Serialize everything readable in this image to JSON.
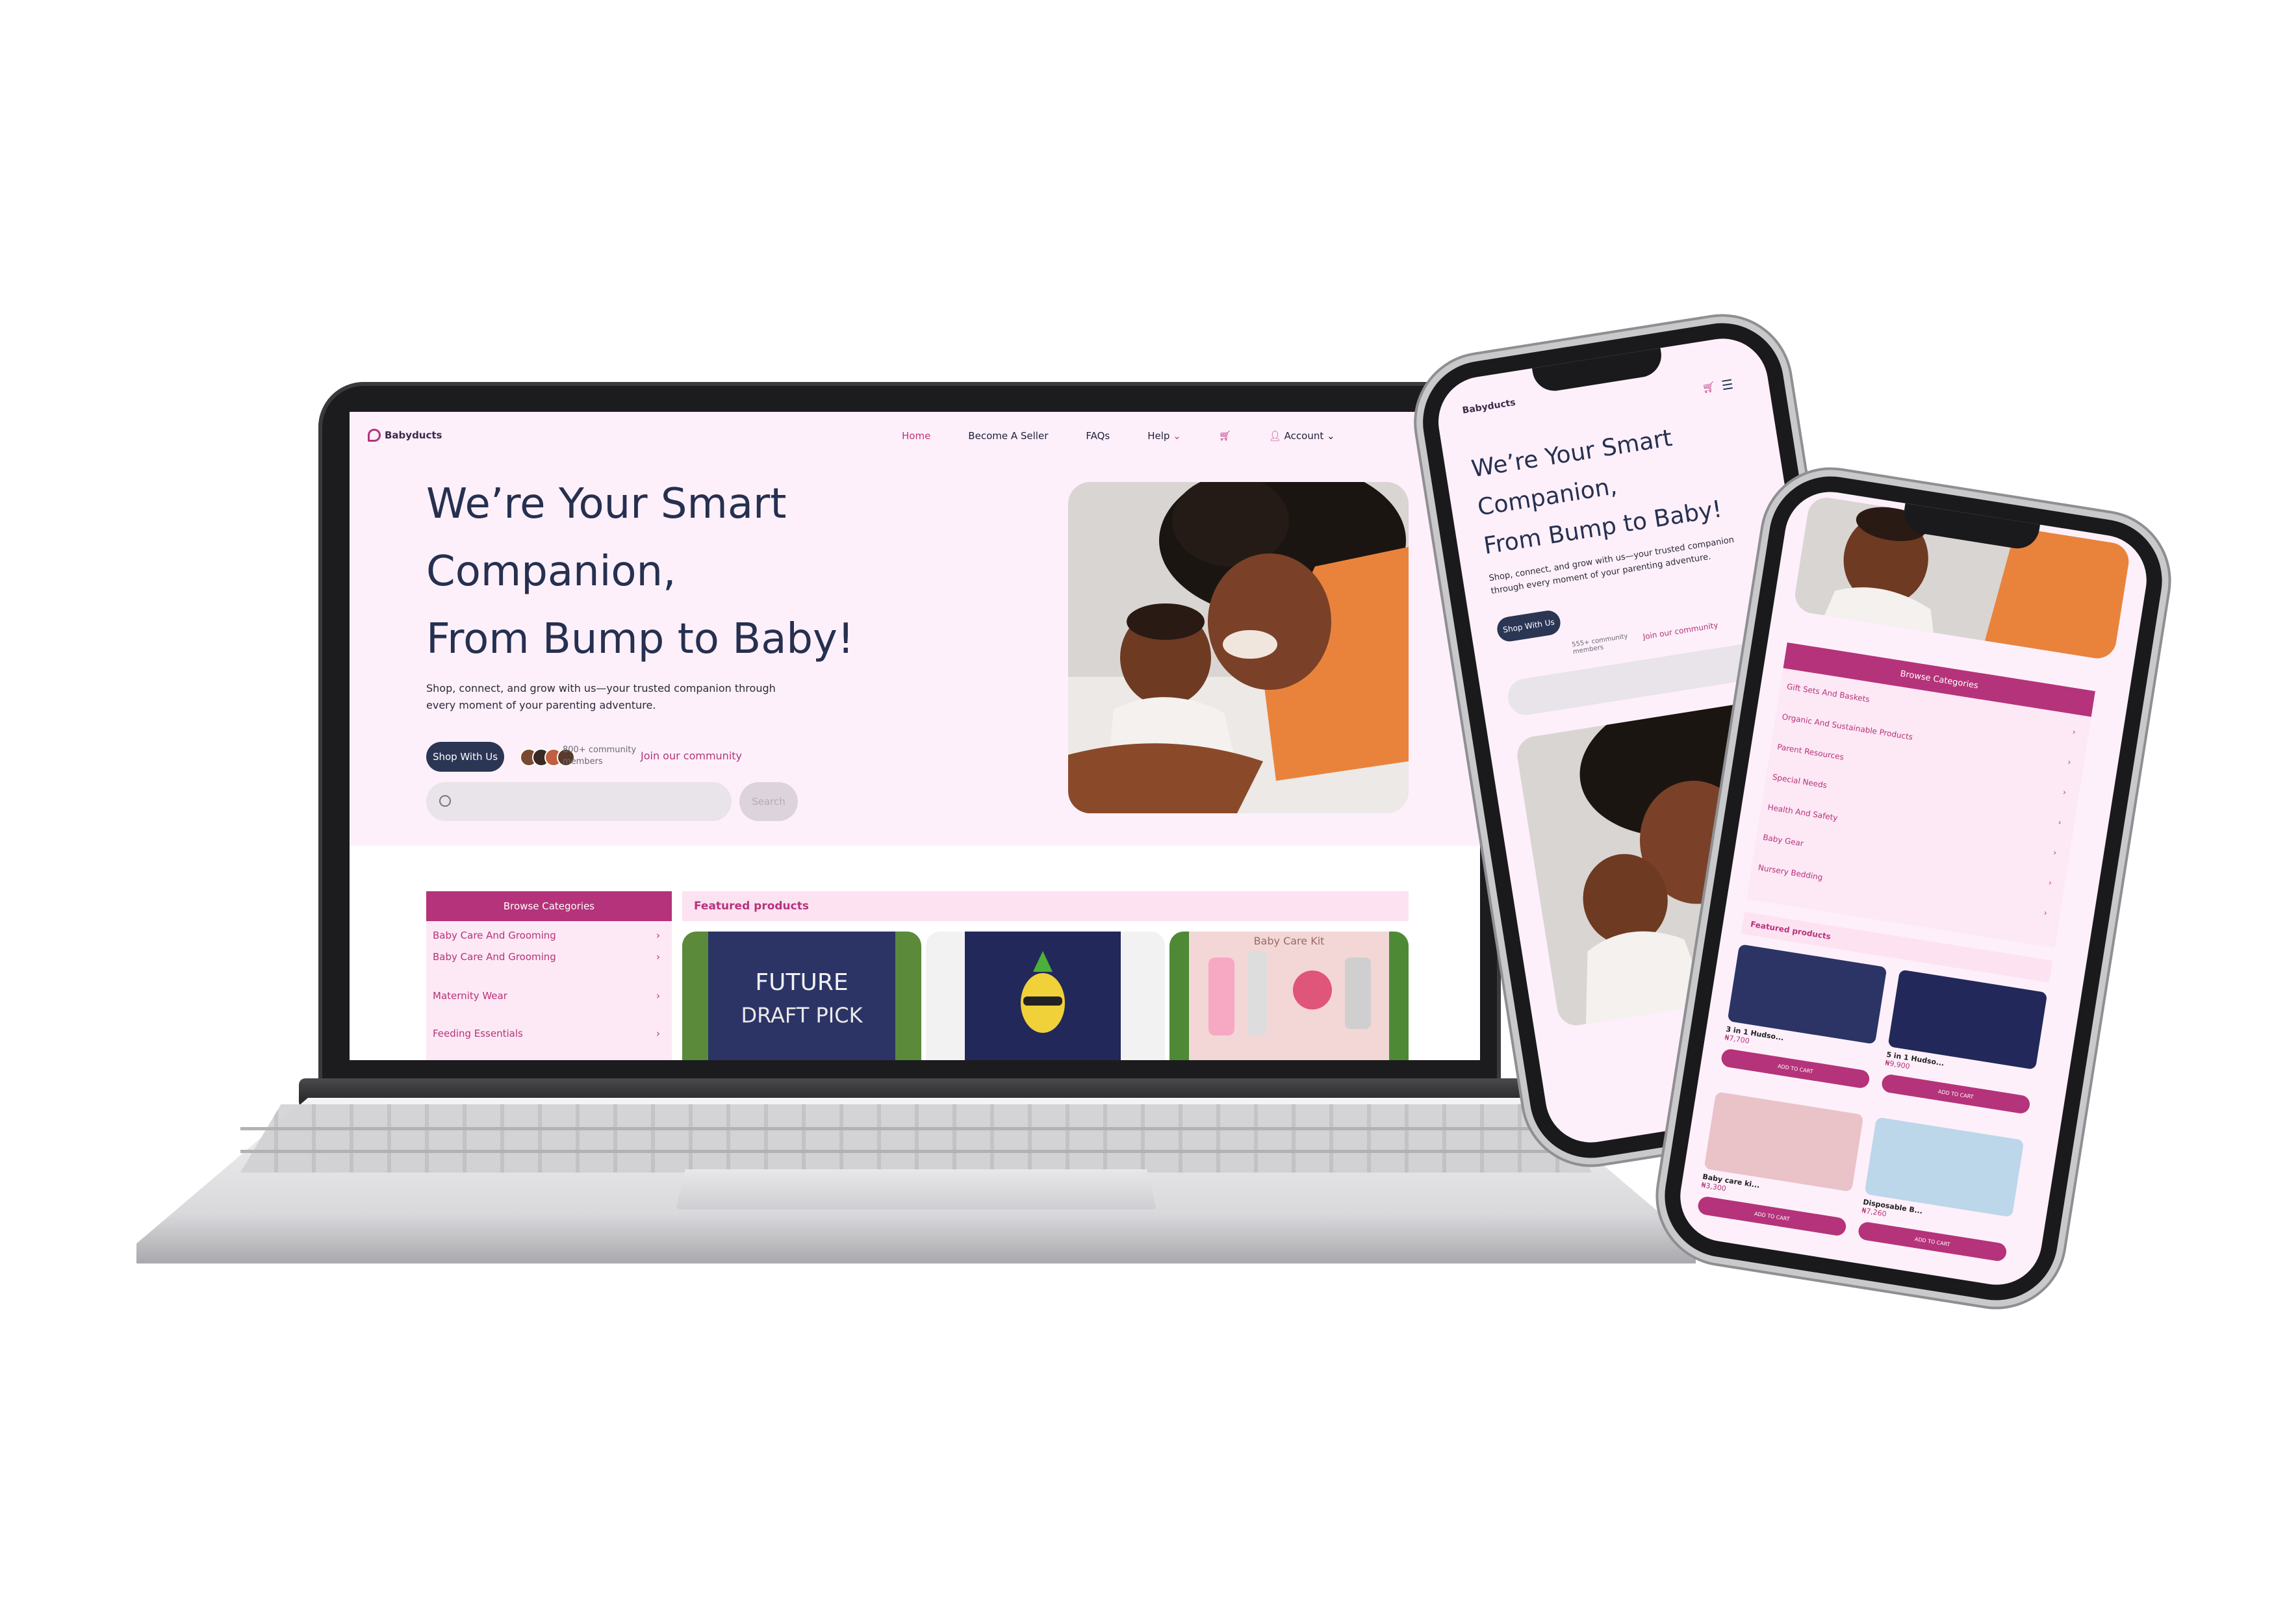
{
  "site": {
    "brand": "Babyducts",
    "nav": {
      "home": "Home",
      "seller": "Become A Seller",
      "faqs": "FAQs",
      "help": "Help",
      "account": "Account"
    },
    "hero": {
      "line1": "We’re Your Smart",
      "line2": "Companion,",
      "line3": "From Bump to Baby!",
      "subtitle": "Shop, connect, and grow with us—your trusted companion through every moment of your parenting adventure.",
      "cta": "Shop With Us",
      "community_count": "800+ community members",
      "join_link": "Join our community",
      "search_button": "Search"
    },
    "categories": {
      "header": "Browse Categories",
      "items": [
        "Baby Care And Grooming",
        "Baby Care And Grooming",
        "Maternity Wear",
        "Feeding Essentials"
      ]
    },
    "featured_header": "Featured products"
  },
  "phone1": {
    "brand": "Babyducts",
    "hero_line1": "We’re Your Smart",
    "hero_line2": "Companion,",
    "hero_line3": "From Bump to Baby!",
    "subtitle": "Shop, connect, and grow with us—your trusted companion through every moment of your parenting adventure.",
    "cta": "Shop With Us",
    "community": "555+ community members",
    "join": "Join our community"
  },
  "phone2": {
    "cat_header": "Browse Categories",
    "categories": [
      "Gift Sets And Baskets",
      "Organic And Sustainable Products",
      "Parent Resources",
      "Special Needs",
      "Health And Safety",
      "Baby Gear",
      "Nursery Bedding"
    ],
    "featured_header": "Featured products",
    "products": [
      {
        "name": "3 in 1 Hudso...",
        "price": "₦7,700",
        "button": "ADD TO CART"
      },
      {
        "name": "5 in 1 Hudso...",
        "price": "₦9,900",
        "button": "ADD TO CART"
      },
      {
        "name": "Baby care ki...",
        "price": "₦3,300",
        "button": "ADD TO CART"
      },
      {
        "name": "Disposable B...",
        "price": "₦7,260",
        "button": "ADD TO CART"
      }
    ]
  },
  "product_prints": {
    "bib1_line1": "FUTURE",
    "bib1_line2": "DRAFT PICK",
    "kit_label": "Baby Care Kit"
  },
  "colors": {
    "brand_pink": "#b5337a",
    "navy": "#2b3554",
    "hero_bg": "#fdf0fa"
  }
}
